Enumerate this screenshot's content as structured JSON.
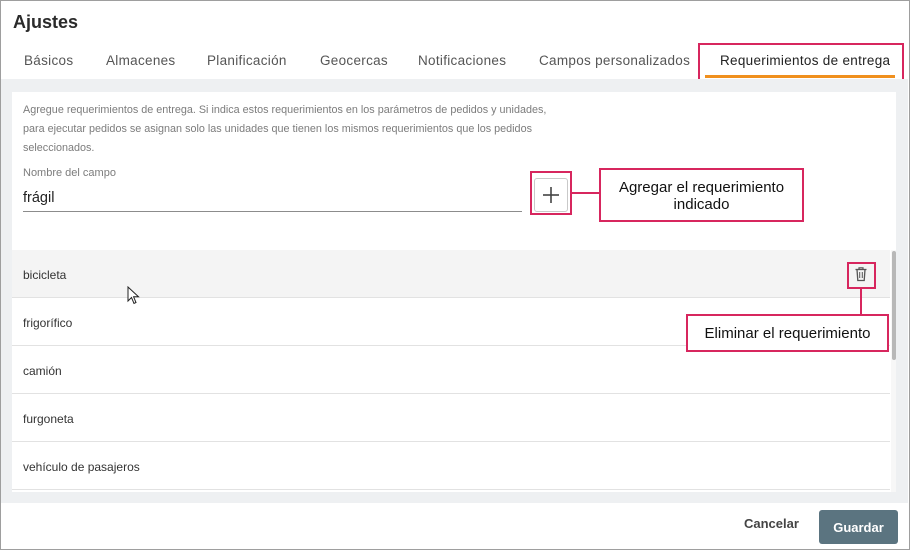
{
  "window": {
    "title": "Ajustes"
  },
  "tabs": [
    {
      "label": "Básicos"
    },
    {
      "label": "Almacenes"
    },
    {
      "label": "Planificación"
    },
    {
      "label": "Geocercas"
    },
    {
      "label": "Notificaciones"
    },
    {
      "label": "Campos personalizados"
    },
    {
      "label": "Requerimientos de entrega",
      "active": true
    }
  ],
  "description": {
    "line1": "Agregue requerimientos de entrega. Si indica estos requerimientos en los parámetros de pedidos y unidades,",
    "line2": "para ejecutar pedidos se asignan solo las unidades que tienen los mismos requerimientos que los pedidos",
    "line3": "seleccionados."
  },
  "field": {
    "label": "Nombre del campo",
    "value": "frágil"
  },
  "add_button": {
    "icon": "plus-icon"
  },
  "requirements": [
    {
      "label": "bicicleta"
    },
    {
      "label": "frigorífico"
    },
    {
      "label": "camión"
    },
    {
      "label": "furgoneta"
    },
    {
      "label": "vehículo de pasajeros"
    }
  ],
  "callouts": {
    "add": {
      "line1": "Agregar el requerimiento",
      "line2": "indicado"
    },
    "delete": {
      "text": "Eliminar el requerimiento"
    }
  },
  "footer": {
    "cancel_label": "Cancelar",
    "save_label": "Guardar"
  },
  "colors": {
    "accent": "#f0901e",
    "annotation": "#d7265e",
    "primary_button": "#5b7480"
  }
}
